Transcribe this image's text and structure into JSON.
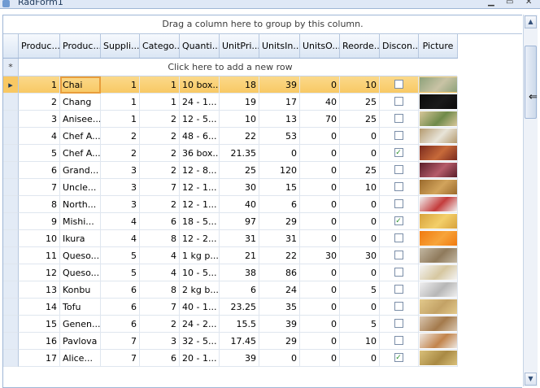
{
  "window": {
    "title": "RadForm1"
  },
  "grid": {
    "group_panel_text": "Drag a column here to group by this column.",
    "new_row_text": "Click here to add a new row",
    "new_row_marker": "*",
    "current_row_marker": "▸",
    "columns": [
      "Produc...",
      "Produc...",
      "Suppli...",
      "Catego...",
      "Quanti...",
      "UnitPri...",
      "UnitsIn...",
      "UnitsO...",
      "Reorde...",
      "Discon...",
      "Picture"
    ],
    "rows": [
      {
        "id": "1",
        "name": "Chai",
        "supplier": "1",
        "category": "1",
        "qty": "10 box...",
        "price": "18",
        "stock": "39",
        "order": "0",
        "reorder": "10",
        "disc": false
      },
      {
        "id": "2",
        "name": "Chang",
        "supplier": "1",
        "category": "1",
        "qty": "24 - 1...",
        "price": "19",
        "stock": "17",
        "order": "40",
        "reorder": "25",
        "disc": false
      },
      {
        "id": "3",
        "name": "Anisee...",
        "supplier": "1",
        "category": "2",
        "qty": "12 - 5...",
        "price": "10",
        "stock": "13",
        "order": "70",
        "reorder": "25",
        "disc": false
      },
      {
        "id": "4",
        "name": "Chef A...",
        "supplier": "2",
        "category": "2",
        "qty": "48 - 6...",
        "price": "22",
        "stock": "53",
        "order": "0",
        "reorder": "0",
        "disc": false
      },
      {
        "id": "5",
        "name": "Chef A...",
        "supplier": "2",
        "category": "2",
        "qty": "36 box...",
        "price": "21.35",
        "stock": "0",
        "order": "0",
        "reorder": "0",
        "disc": true
      },
      {
        "id": "6",
        "name": "Grand...",
        "supplier": "3",
        "category": "2",
        "qty": "12 - 8...",
        "price": "25",
        "stock": "120",
        "order": "0",
        "reorder": "25",
        "disc": false
      },
      {
        "id": "7",
        "name": "Uncle...",
        "supplier": "3",
        "category": "7",
        "qty": "12 - 1...",
        "price": "30",
        "stock": "15",
        "order": "0",
        "reorder": "10",
        "disc": false
      },
      {
        "id": "8",
        "name": "North...",
        "supplier": "3",
        "category": "2",
        "qty": "12 - 1...",
        "price": "40",
        "stock": "6",
        "order": "0",
        "reorder": "0",
        "disc": false
      },
      {
        "id": "9",
        "name": "Mishi...",
        "supplier": "4",
        "category": "6",
        "qty": "18 - 5...",
        "price": "97",
        "stock": "29",
        "order": "0",
        "reorder": "0",
        "disc": true
      },
      {
        "id": "10",
        "name": "Ikura",
        "supplier": "4",
        "category": "8",
        "qty": "12 - 2...",
        "price": "31",
        "stock": "31",
        "order": "0",
        "reorder": "0",
        "disc": false
      },
      {
        "id": "11",
        "name": "Queso...",
        "supplier": "5",
        "category": "4",
        "qty": "1 kg p...",
        "price": "21",
        "stock": "22",
        "order": "30",
        "reorder": "30",
        "disc": false
      },
      {
        "id": "12",
        "name": "Queso...",
        "supplier": "5",
        "category": "4",
        "qty": "10 - 5...",
        "price": "38",
        "stock": "86",
        "order": "0",
        "reorder": "0",
        "disc": false
      },
      {
        "id": "13",
        "name": "Konbu",
        "supplier": "6",
        "category": "8",
        "qty": "2 kg b...",
        "price": "6",
        "stock": "24",
        "order": "0",
        "reorder": "5",
        "disc": false
      },
      {
        "id": "14",
        "name": "Tofu",
        "supplier": "6",
        "category": "7",
        "qty": "40 - 1...",
        "price": "23.25",
        "stock": "35",
        "order": "0",
        "reorder": "0",
        "disc": false
      },
      {
        "id": "15",
        "name": "Genen...",
        "supplier": "6",
        "category": "2",
        "qty": "24 - 2...",
        "price": "15.5",
        "stock": "39",
        "order": "0",
        "reorder": "5",
        "disc": false
      },
      {
        "id": "16",
        "name": "Pavlova",
        "supplier": "7",
        "category": "3",
        "qty": "32 - 5...",
        "price": "17.45",
        "stock": "29",
        "order": "0",
        "reorder": "10",
        "disc": false
      },
      {
        "id": "17",
        "name": "Alice...",
        "supplier": "7",
        "category": "6",
        "qty": "20 - 1...",
        "price": "39",
        "stock": "0",
        "order": "0",
        "reorder": "0",
        "disc": true
      }
    ]
  },
  "colors": {
    "current_row": "#f8c863",
    "focus_border": "#e89d3b",
    "header": "#dbe6f4",
    "grid_border": "#9fb6d6"
  },
  "icons": {
    "current_row": "current-row-indicator-icon",
    "new_row": "new-row-star-icon",
    "checked": "checkmark-icon",
    "scroll_up": "scroll-up-arrow-icon",
    "scroll_down": "scroll-down-arrow-icon",
    "cursor": "resize-cursor-icon"
  },
  "picture_colors": [
    [
      "#8ea27a",
      "#c9c3a5"
    ],
    [
      "#0b0b0b",
      "#1a1a1a"
    ],
    [
      "#d8c79a",
      "#6f8a4a"
    ],
    [
      "#b49a6f",
      "#e8e4d8"
    ],
    [
      "#7a2a1e",
      "#c76a3a"
    ],
    [
      "#5a1e2a",
      "#b55c6b"
    ],
    [
      "#9a6a2c",
      "#d2a45c"
    ],
    [
      "#f1f1f1",
      "#c43c3c"
    ],
    [
      "#d7a23c",
      "#f3cf6a"
    ],
    [
      "#f07a10",
      "#f7a43a"
    ],
    [
      "#c2b7a2",
      "#8f7a5c"
    ],
    [
      "#f4f4f4",
      "#d6c7a0"
    ],
    [
      "#efeff0",
      "#b7b7b7"
    ],
    [
      "#e2c98c",
      "#c3a266"
    ],
    [
      "#d9c6b0",
      "#a47a4c"
    ],
    [
      "#eee8e2",
      "#c2844c"
    ],
    [
      "#d9c07a",
      "#a98a44"
    ]
  ]
}
